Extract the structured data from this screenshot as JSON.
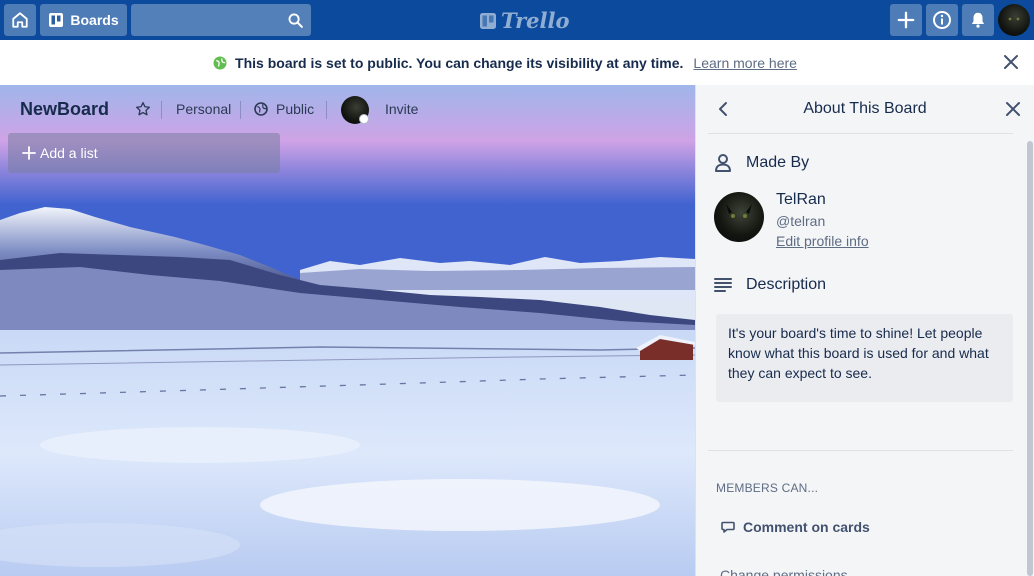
{
  "topbar": {
    "home_icon": "home-icon",
    "boards_label": "Boards",
    "search_placeholder": "",
    "logo_text": "Trello",
    "add_icon": "plus-icon",
    "info_icon": "info-icon",
    "notification_icon": "bell-icon"
  },
  "banner": {
    "icon": "globe-icon",
    "text": "This board is set to public. You can change its visibility at any time.",
    "link": "Learn more here"
  },
  "board": {
    "title": "NewBoard",
    "team": "Personal",
    "visibility": "Public",
    "invite": "Invite",
    "add_list": "Add a list"
  },
  "sidebar": {
    "title": "About This Board",
    "made_by_label": "Made By",
    "author_name": "TelRan",
    "author_handle": "@telran",
    "edit_profile": "Edit profile info",
    "description_label": "Description",
    "description_text": "It's your board's time to shine! Let people know what this board is used for and what they can expect to see.",
    "members_can_label": "MEMBERS CAN...",
    "comment_permission": "Comment on cards",
    "change_permissions": "Change permissions"
  },
  "colors": {
    "topbar": "#0b4a9c",
    "banner_bg": "#ffffff",
    "sidebar_bg": "#f4f5f7",
    "globe_icon": "#61bd4f"
  }
}
